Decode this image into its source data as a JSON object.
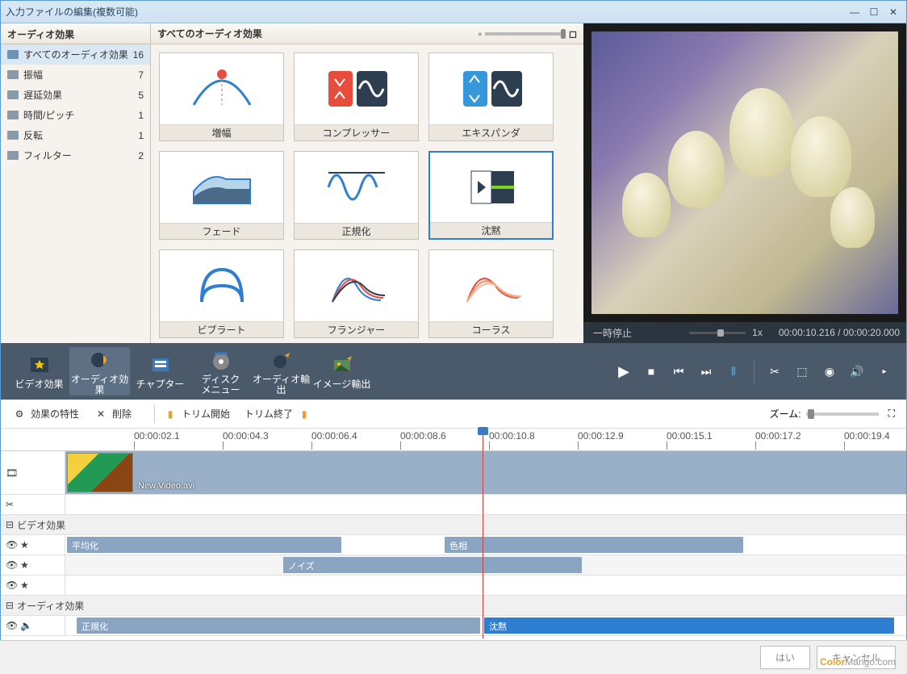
{
  "window": {
    "title": "入力ファイルの編集(複数可能)"
  },
  "sidebar": {
    "header": "オーディオ効果",
    "items": [
      {
        "label": "すべてのオーディオ効果",
        "count": 16,
        "selected": true
      },
      {
        "label": "振幅",
        "count": 7
      },
      {
        "label": "遅延効果",
        "count": 5
      },
      {
        "label": "時間/ピッチ",
        "count": 1
      },
      {
        "label": "反転",
        "count": 1
      },
      {
        "label": "フィルター",
        "count": 2
      }
    ]
  },
  "effects": {
    "header": "すべてのオーディオ効果",
    "items": [
      {
        "label": "増幅"
      },
      {
        "label": "コンプレッサー"
      },
      {
        "label": "エキスパンダ"
      },
      {
        "label": "フェード"
      },
      {
        "label": "正規化"
      },
      {
        "label": "沈黙",
        "selected": true
      },
      {
        "label": "ビブラート"
      },
      {
        "label": "フランジャー"
      },
      {
        "label": "コーラス"
      }
    ]
  },
  "preview": {
    "status": "一時停止",
    "speed": "1x",
    "current_time": "00:00:10.216",
    "total_time": "00:00:20.000"
  },
  "toolbar": {
    "buttons": [
      {
        "label": "ビデオ効果"
      },
      {
        "label": "オーディオ効果",
        "selected": true
      },
      {
        "label": "チャプター"
      },
      {
        "label": "ディスク\nメニュー"
      },
      {
        "label": "オーディオ輸出"
      },
      {
        "label": "イメージ輸出"
      }
    ]
  },
  "subbar": {
    "properties": "効果の特性",
    "delete": "削除",
    "trim_start": "トリム開始",
    "trim_end": "トリム終了",
    "zoom_label": "ズーム:"
  },
  "timeline": {
    "ticks": [
      "00:00:02.1",
      "00:00:04.3",
      "00:00:06.4",
      "00:00:08.6",
      "00:00:10.8",
      "00:00:12.9",
      "00:00:15.1",
      "00:00:17.2",
      "00:00:19.4"
    ],
    "video_clip": "New Video.avi",
    "groups": {
      "video_effects": "ビデオ効果",
      "audio_effects": "オーディオ効果"
    },
    "clips": {
      "equalization": "平均化",
      "hue": "色相",
      "noise": "ノイズ",
      "normalize": "正規化",
      "silence": "沈黙"
    }
  },
  "footer": {
    "ok": "はい",
    "cancel": "キャンセル"
  },
  "watermark": {
    "brand": "Color",
    "rest": "Mango.com"
  }
}
